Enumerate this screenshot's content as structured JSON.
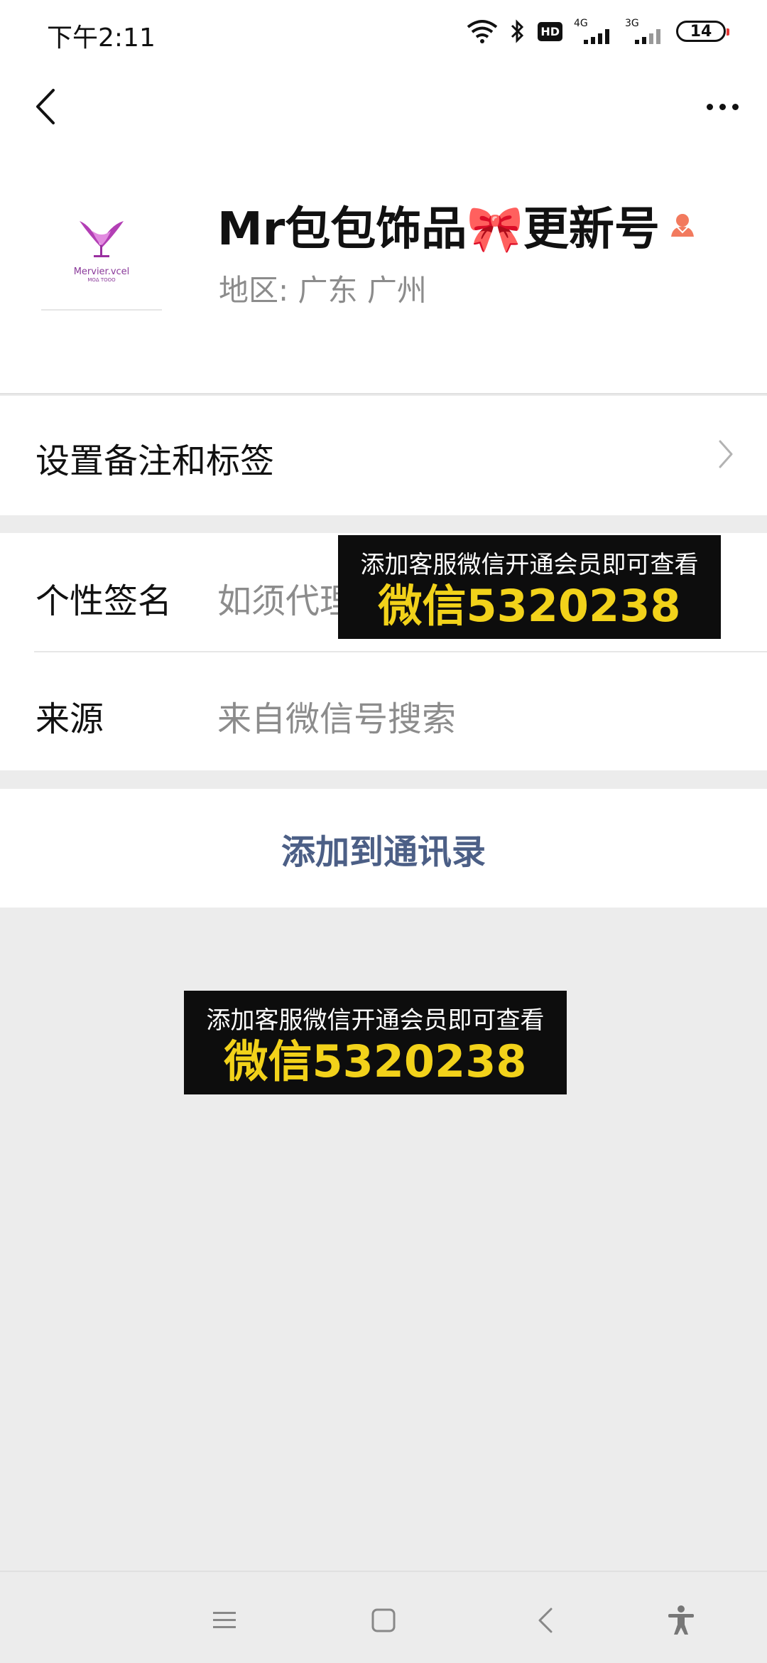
{
  "status_bar": {
    "time": "下午2:11",
    "hd_badge": "HD",
    "net_4g": "4G",
    "net_3g": "3G",
    "battery": "14"
  },
  "profile": {
    "nickname": "Mr包包饰品🎀更新号",
    "region": "地区:  广东  广州",
    "avatar_text": "Mervier.vcel",
    "avatar_subtext": "ΜΟΔ ΤΟΟΟ"
  },
  "rows": {
    "remark_label": "设置备注和标签",
    "signature_label": "个性签名",
    "signature_value": "如须代理",
    "source_label": "来源",
    "source_value": "来自微信号搜索"
  },
  "actions": {
    "add_contact": "添加到通讯录"
  },
  "banners": {
    "top_line1": "添加客服微信开通会员即可查看",
    "top_line2": "微信5320238",
    "mid_line1": "添加客服微信开通会员即可查看",
    "mid_line2": "微信5320238"
  },
  "colors": {
    "link_blue": "#4c5f86",
    "banner_yellow": "#f2d21a",
    "gender_female": "#f27a5e"
  },
  "icons": {
    "back": "back-arrow-icon",
    "more": "more-dots-icon",
    "chevron": "chevron-right-icon",
    "nav_menu": "menu-icon",
    "nav_home": "home-square-icon",
    "nav_back": "back-triangle-icon",
    "nav_accessibility": "accessibility-icon"
  }
}
